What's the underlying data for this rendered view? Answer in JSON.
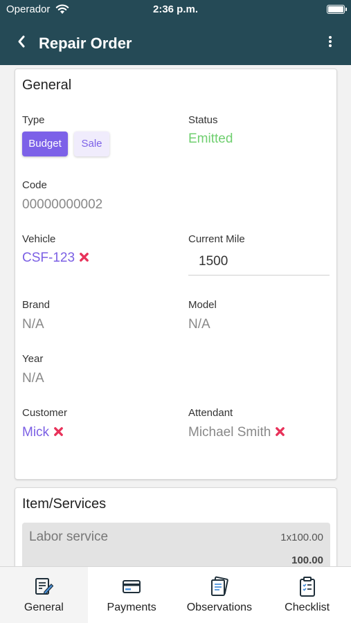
{
  "status_bar": {
    "carrier": "Operador",
    "time": "2:36 p.m."
  },
  "navbar": {
    "title": "Repair Order"
  },
  "general": {
    "title": "General",
    "type_label": "Type",
    "type_options": {
      "budget": "Budget",
      "sale": "Sale"
    },
    "type_selected": "Budget",
    "status_label": "Status",
    "status_value": "Emitted",
    "code_label": "Code",
    "code_value": "00000000002",
    "vehicle_label": "Vehicle",
    "vehicle_value": "CSF-123",
    "current_mile_label": "Current Mile",
    "current_mile_value": "1500",
    "brand_label": "Brand",
    "brand_value": "N/A",
    "model_label": "Model",
    "model_value": "N/A",
    "year_label": "Year",
    "year_value": "N/A",
    "customer_label": "Customer",
    "customer_value": "Mick",
    "attendant_label": "Attendant",
    "attendant_value": "Michael Smith"
  },
  "items": {
    "title": "Item/Services",
    "rows": [
      {
        "name": "Labor service",
        "qty": "1x100.00",
        "total": "100.00"
      }
    ]
  },
  "tabs": [
    {
      "label": "General",
      "icon": "edit-document-icon",
      "active": true
    },
    {
      "label": "Payments",
      "icon": "credit-card-icon",
      "active": false
    },
    {
      "label": "Observations",
      "icon": "notes-icon",
      "active": false
    },
    {
      "label": "Checklist",
      "icon": "clipboard-checklist-icon",
      "active": false
    }
  ],
  "colors": {
    "header": "#254a56",
    "accent": "#7c61e8",
    "status_emitted": "#6fcf6f",
    "remove": "#e8325a"
  }
}
